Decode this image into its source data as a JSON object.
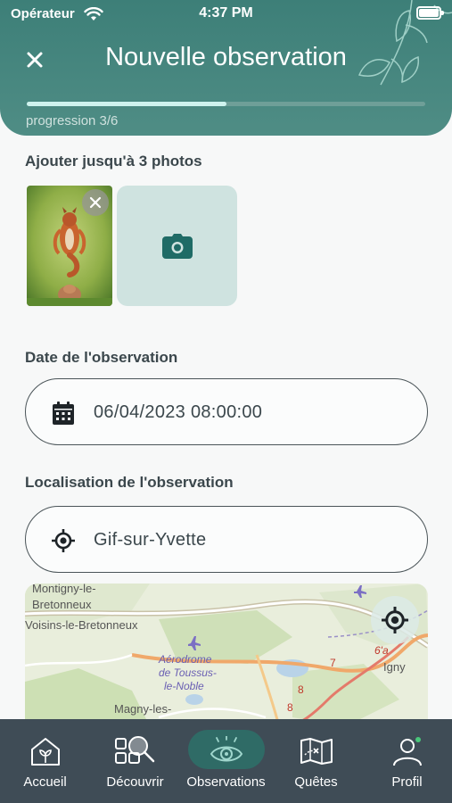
{
  "status_bar": {
    "carrier": "Opérateur",
    "time": "4:37 PM"
  },
  "header": {
    "title": "Nouvelle observation",
    "progress_label": "progression 3/6",
    "progress_fraction": 0.5,
    "close_icon": "close-icon"
  },
  "photos": {
    "label": "Ajouter jusqu'à 3 photos",
    "count": 1,
    "add_icon": "camera-icon",
    "remove_icon": "close-icon"
  },
  "date": {
    "label": "Date de l'observation",
    "value": "06/04/2023 08:00:00",
    "icon": "calendar-icon"
  },
  "location": {
    "label": "Localisation de l'observation",
    "value": "Gif-sur-Yvette",
    "icon": "crosshair-icon"
  },
  "map": {
    "places": [
      "Montigny-le-",
      "Bretonneux",
      "Voisins-le-Bretonneux",
      "Aérodrome",
      "de Toussus-",
      "le-Noble",
      "Magny-les-",
      "Igny"
    ],
    "roads": [
      "7",
      "8",
      "8",
      "6'a"
    ],
    "locate_icon": "crosshair-icon"
  },
  "tabs": [
    {
      "label": "Accueil",
      "icon": "home-icon",
      "active": false
    },
    {
      "label": "Découvrir",
      "icon": "discover-icon",
      "active": false
    },
    {
      "label": "Observations",
      "icon": "eye-icon",
      "active": true
    },
    {
      "label": "Quêtes",
      "icon": "map-quest-icon",
      "active": false
    },
    {
      "label": "Profil",
      "icon": "profile-icon",
      "active": false
    }
  ],
  "colors": {
    "header": "#3d7f78",
    "accent": "#1f6b66",
    "progress_fill": "#cff3ee",
    "tabbar": "#3f4c56",
    "tab_active": "#2f6b66",
    "notification_dot": "#49c77a"
  }
}
